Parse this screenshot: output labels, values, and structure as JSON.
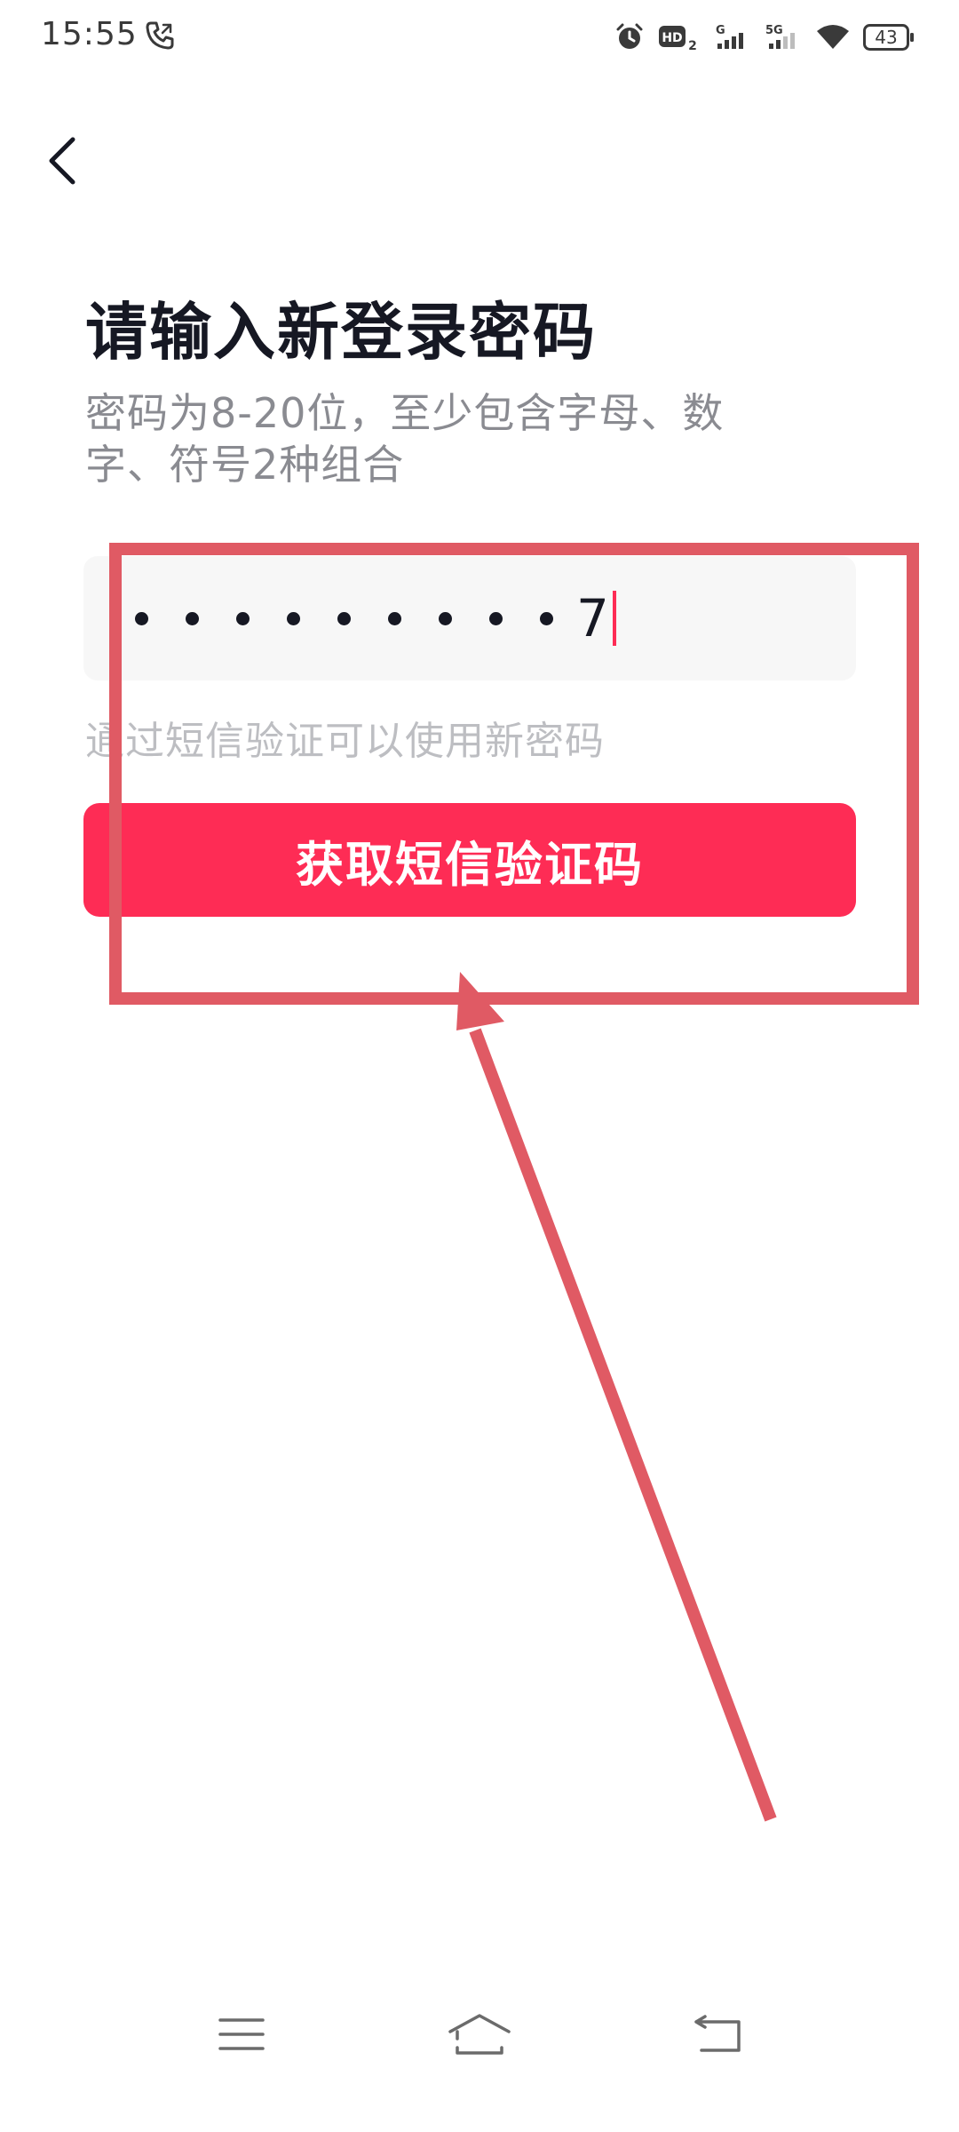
{
  "status_bar": {
    "time": "15:55",
    "network_labels": [
      "HD",
      "2",
      "G",
      "5G"
    ],
    "battery": "43",
    "icons": [
      "phone-call-icon",
      "alarm-icon",
      "hd-icon",
      "signal-g-icon",
      "signal-5g-icon",
      "wifi-icon",
      "battery-icon"
    ]
  },
  "header": {
    "back_icon": "chevron-left-icon"
  },
  "main": {
    "title": "请输入新登录密码",
    "hint": "密码为8-20位，至少包含字母、数字、符号2种组合",
    "password_field": {
      "masked_count": 9,
      "last_char": "7"
    },
    "sms_tip": "通过短信验证可以使用新密码",
    "sms_button_label": "获取短信验证码"
  },
  "colors": {
    "accent": "#fe2c55",
    "annotation": "#e05a64",
    "title": "#161823",
    "hint": "#8a8b91",
    "tip": "#bdbec2",
    "field_bg": "#f7f7f7"
  },
  "nav_bar": {
    "icons": [
      "menu-icon",
      "home-icon",
      "back-icon"
    ]
  }
}
